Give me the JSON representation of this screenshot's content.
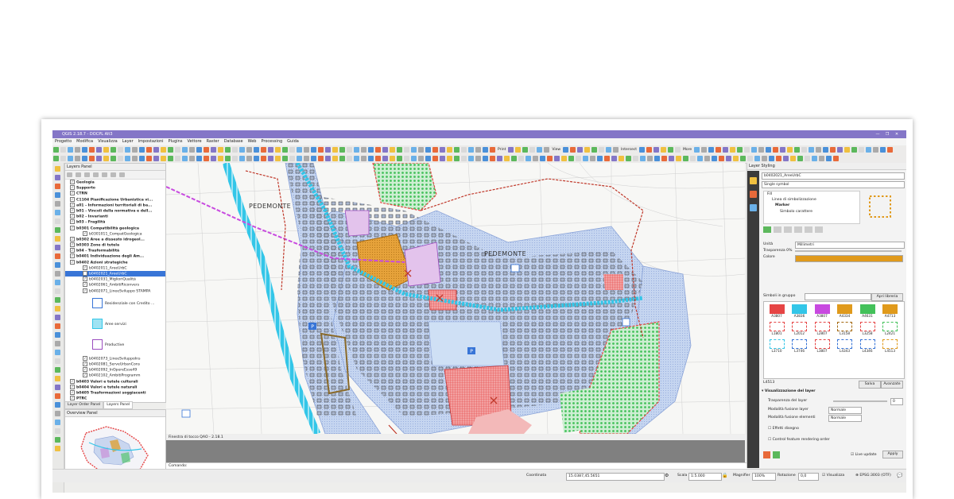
{
  "window": {
    "title": "QGIS 2.18.7 - DOCPL Alt3",
    "controls": [
      "—",
      "❐",
      "✕"
    ]
  },
  "menu": [
    "Progetto",
    "Modifica",
    "Visualizza",
    "Layer",
    "Impostazioni",
    "Plugins",
    "Vettore",
    "Raster",
    "Database",
    "Web",
    "Processing",
    "Guida"
  ],
  "toolbar": {
    "labels": [
      "Print",
      "View",
      "Intersect",
      "More"
    ]
  },
  "layers_panel": {
    "title": "Layers Panel",
    "rows": [
      {
        "text": "Geologia",
        "bold": true
      },
      {
        "text": "Supporto",
        "bold": true
      },
      {
        "text": "CTRN",
        "bold": true
      },
      {
        "text": "C1104 Pianificazione Urbanistica vi...",
        "bold": true
      },
      {
        "text": "a01 - Informazioni territoriali di ba...",
        "bold": true
      },
      {
        "text": "b01 - Vincoli della normativa e dell...",
        "bold": true
      },
      {
        "text": "b02 - Invarianti",
        "bold": true
      },
      {
        "text": "b03 - Fragilità",
        "bold": true
      },
      {
        "text": "b0301 Compatibilità geologica",
        "bold": true
      },
      {
        "text": "b0301011_CompatGeologica",
        "bold": false
      },
      {
        "text": "b0302 Aree a dissesto idrogeol...",
        "bold": true
      },
      {
        "text": "b0303 Zone di tutela",
        "bold": true
      },
      {
        "text": "b04 - Trasformabilità",
        "bold": true
      },
      {
        "text": "b0401 Individuazione degli Am...",
        "bold": true
      },
      {
        "text": "b0402 Azioni strategiche",
        "bold": true
      },
      {
        "text": "b0402011_AreeUrbC",
        "bold": false
      },
      {
        "text": "b0402021_AreeUrbC",
        "bold": false,
        "selected": true
      },
      {
        "text": "b0402031_MiglioriQualità",
        "bold": false
      },
      {
        "text": "b0402061_AmbitiRiconvers",
        "bold": false
      },
      {
        "text": "b0402071_LineeSviluppo STAMPA",
        "bold": false
      }
    ],
    "legend_items": [
      "Residenziale con Credito ...",
      "Aree servizi",
      "Productive"
    ],
    "rows2": [
      {
        "text": "b0402073_LineeSviluppoIns",
        "bold": false
      },
      {
        "text": "b0402081_ServeUrbanCons",
        "bold": false
      },
      {
        "text": "b0402092_InOpereEsse49",
        "bold": false
      },
      {
        "text": "b0402102_AmbitiProgramm",
        "bold": false
      },
      {
        "text": "b0403 Valori e tutele culturali",
        "bold": true
      },
      {
        "text": "b0404 Valori e tutele naturali",
        "bold": true
      },
      {
        "text": "b0405 Trasformazioni soggiacenti",
        "bold": true
      },
      {
        "text": "PTRC",
        "bold": true
      },
      {
        "text": "PTCP",
        "bold": true
      }
    ]
  },
  "panel_tabs": [
    "Layer Order Panel",
    "Layers Panel"
  ],
  "overview_panel": {
    "title": "Overview Panel"
  },
  "map": {
    "labels": [
      "PEDEMONTE",
      "PEDEMONTE"
    ]
  },
  "python_console": {
    "title": "Finestra di tocco QAO - 2.18.1",
    "command_label": "Comando:"
  },
  "layer_styling": {
    "title": "Layer Styling",
    "layer": "b0402021_AreeUrbC",
    "renderer": "Single symbol",
    "tree": [
      "Fill",
      "Linea di simbolizzazione",
      "Marker",
      "Simbolo carattere"
    ],
    "unit_label": "Unità",
    "unit_value": "Millimetri",
    "transparency_label": "Trasparenza 0%",
    "color_label": "Colore",
    "symbols_group_label": "Simboli in gruppo",
    "open_library": "Apri libreria",
    "symbols": [
      "A3807",
      "A3836",
      "A3807",
      "A4334",
      "A4631",
      "A4713",
      "L1801",
      "L2012",
      "L2807",
      "L3158",
      "L3258",
      "L2421",
      "L3710",
      "L3746",
      "L3807",
      "L4343",
      "L4346",
      "L4513"
    ],
    "selected_symbol": "L4513",
    "save": "Salva",
    "advanced": "Avanzate",
    "layer_rendering": "Visualizzazione del layer",
    "layer_transparency": "Trasparenza del layer",
    "layer_transparency_value": "0",
    "blend_layer_label": "Modalità fusione layer",
    "blend_layer_value": "Normale",
    "blend_feature_label": "Modalità fusione elementi",
    "blend_feature_value": "Normale",
    "draw_effects": "Effetti disegno",
    "control_order": "Control feature rendering order",
    "live_update": "Live update",
    "apply": "Apply"
  },
  "status_bar": {
    "coord_label": "Coordinata",
    "coord_value": "15.0387,45.5651",
    "scale_label": "Scala",
    "scale_value": "1:5.000",
    "magnifier_label": "Magnifier",
    "magnifier_value": "100%",
    "rotation_label": "Rotazione",
    "rotation_value": "0,0",
    "render_label": "Visualizza",
    "crs": "EPSG:3003 (OTF)"
  },
  "colors": {
    "title_bar": "#8476c7",
    "selection": "#3875d7",
    "cyan": "#33c6e8",
    "orange": "#e09a1c",
    "red": "#e64545",
    "green": "#43c15a"
  }
}
